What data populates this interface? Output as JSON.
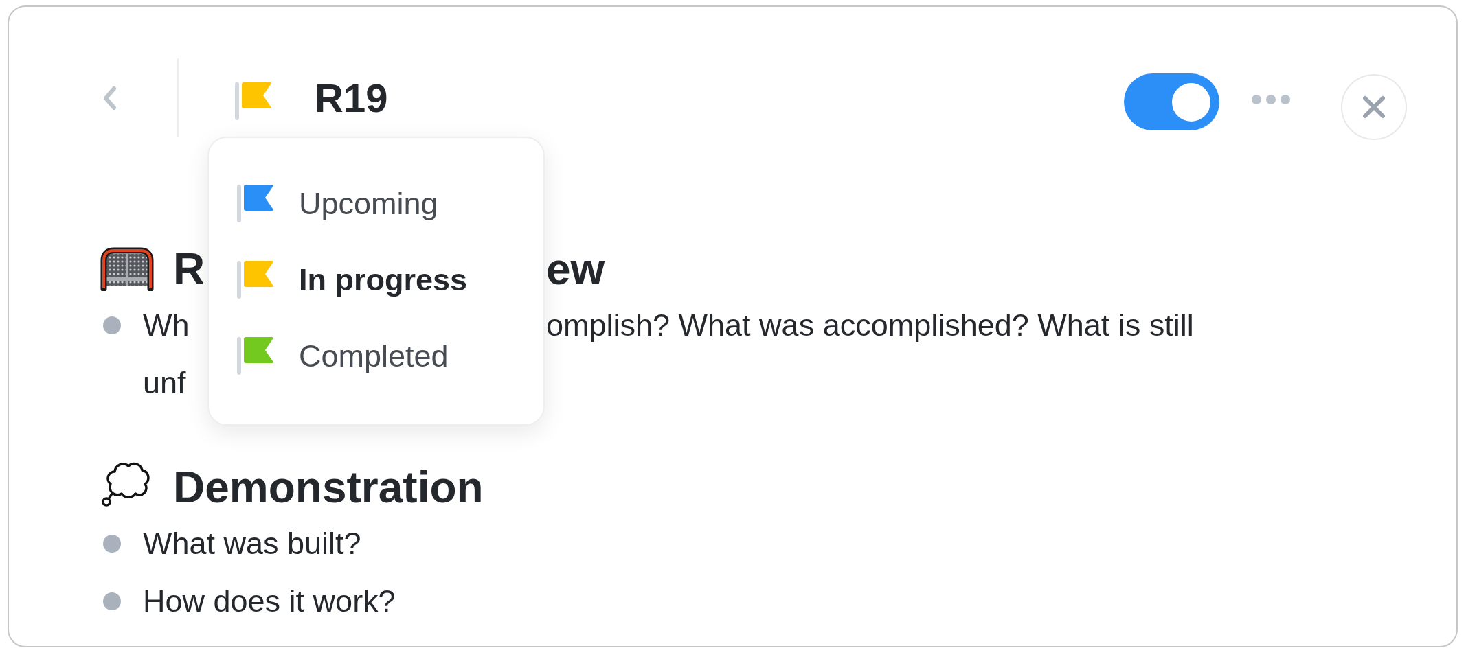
{
  "header": {
    "title": "R19",
    "toggle": {
      "on": true
    }
  },
  "status_menu": {
    "options": [
      {
        "label": "Upcoming",
        "color": "#2a8ff7",
        "selected": false
      },
      {
        "label": "In progress",
        "color": "#ffc400",
        "selected": true
      },
      {
        "label": "Completed",
        "color": "#74c920",
        "selected": false
      }
    ]
  },
  "sections": [
    {
      "kind": "goal",
      "title": [
        "R",
        "ew"
      ],
      "bullets": [
        {
          "lines": [
            [
              "Wh",
              "omplish? What was accomplished? What is still"
            ],
            [
              "unf"
            ]
          ]
        }
      ]
    },
    {
      "kind": "thought",
      "title": [
        "Demonstration"
      ],
      "bullets": [
        {
          "lines": [
            [
              "What was built?"
            ]
          ]
        },
        {
          "lines": [
            [
              "How does it work?"
            ]
          ]
        }
      ]
    }
  ]
}
